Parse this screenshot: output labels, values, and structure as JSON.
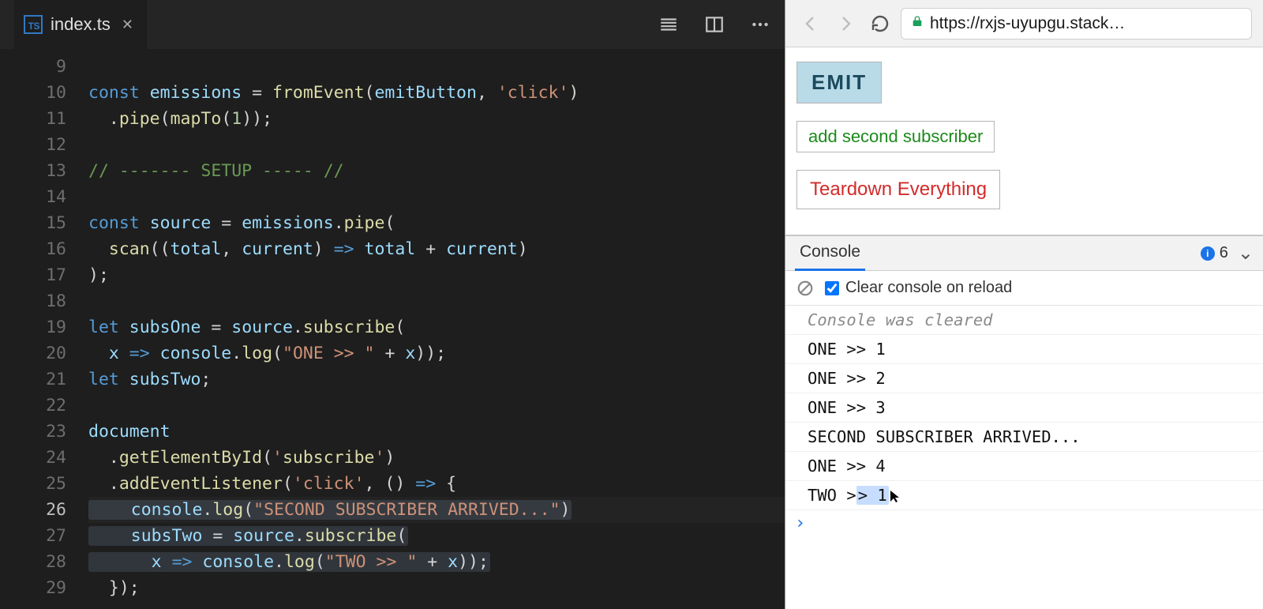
{
  "editor": {
    "tab": {
      "filename": "index.ts",
      "lang_badge": "TS"
    },
    "first_line_number": 9,
    "lines": [
      "",
      "const emissions = fromEvent(emitButton, 'click')",
      "  .pipe(mapTo(1));",
      "",
      "// ------- SETUP ----- //",
      "",
      "const source = emissions.pipe(",
      "  scan((total, current) => total + current)",
      ");",
      "",
      "let subsOne = source.subscribe(",
      "  x => console.log(\"ONE >> \" + x));",
      "let subsTwo;",
      "",
      "document",
      "  .getElementById('subscribe')",
      "  .addEventListener('click', () => {",
      "    console.log(\"SECOND SUBSCRIBER ARRIVED...\")",
      "    subsTwo = source.subscribe(",
      "      x => console.log(\"TWO >> \" + x));",
      "  });"
    ],
    "current_line": 26
  },
  "browser": {
    "url": "https://rxjs-uyupgu.stack…",
    "buttons": {
      "emit": "EMIT",
      "add_subscriber": "add second subscriber",
      "teardown": "Teardown Everything"
    }
  },
  "devtools": {
    "tab_label": "Console",
    "info_count": "6",
    "clear_label": "Clear console on reload",
    "clear_checked": true,
    "log": [
      {
        "text": "Console was cleared",
        "cls": "log-clear"
      },
      {
        "text": "ONE >> 1"
      },
      {
        "text": "ONE >> 2"
      },
      {
        "text": "ONE >> 3"
      },
      {
        "text": "SECOND SUBSCRIBER ARRIVED..."
      },
      {
        "text": "ONE >> 4"
      },
      {
        "text": "TWO >> 1",
        "selected_tail": "> 1"
      }
    ]
  }
}
